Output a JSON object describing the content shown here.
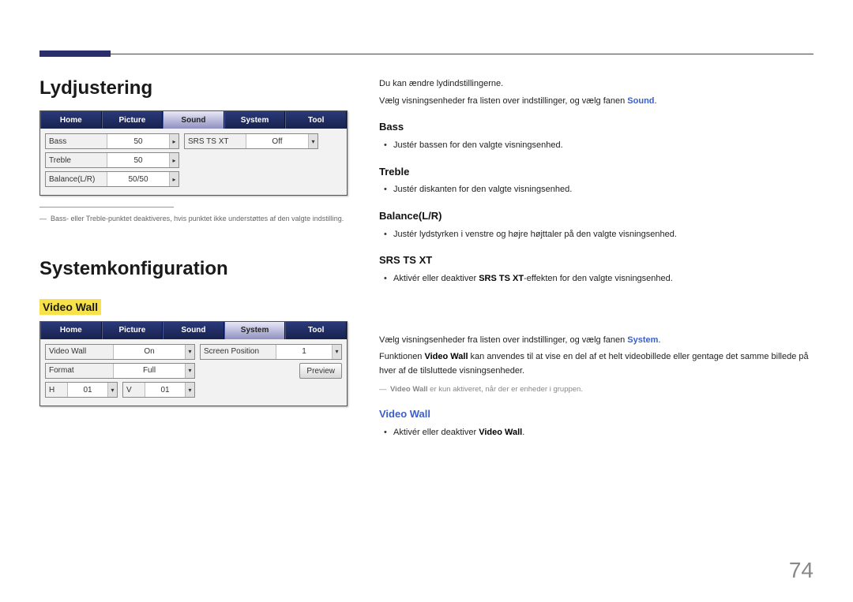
{
  "page_number": "74",
  "section1": {
    "title": "Lydjustering",
    "tabs": {
      "home": "Home",
      "picture": "Picture",
      "sound": "Sound",
      "system": "System",
      "tool": "Tool"
    },
    "fields": {
      "bass_label": "Bass",
      "bass_val": "50",
      "treble_label": "Treble",
      "treble_val": "50",
      "balance_label": "Balance(L/R)",
      "balance_val": "50/50",
      "srs_label": "SRS TS XT",
      "srs_val": "Off"
    },
    "footnote_pre": "Bass",
    "footnote_mid": "- eller ",
    "footnote_item": "Treble",
    "footnote_post": "-punktet deaktiveres, hvis punktet ikke understøttes af den valgte indstilling."
  },
  "section2": {
    "title": "Systemkonfiguration",
    "highlight": "Video Wall",
    "tabs": {
      "home": "Home",
      "picture": "Picture",
      "sound": "Sound",
      "system": "System",
      "tool": "Tool"
    },
    "fields": {
      "vw_label": "Video Wall",
      "vw_val": "On",
      "format_label": "Format",
      "format_val": "Full",
      "h_label": "H",
      "h_val": "01",
      "v_label": "V",
      "v_val": "01",
      "sp_label": "Screen Position",
      "sp_val": "1",
      "preview": "Preview"
    }
  },
  "right": {
    "intro1": "Du kan ændre lydindstillingerne.",
    "intro2a": "Vælg visningsenheder fra listen over indstillinger, og vælg fanen ",
    "intro2b": "Sound",
    "intro2c": ".",
    "bass_h": "Bass",
    "bass_b": "Justér bassen for den valgte visningsenhed.",
    "treble_h": "Treble",
    "treble_b": "Justér diskanten for den valgte visningsenhed.",
    "bal_h": "Balance(L/R)",
    "bal_b": "Justér lydstyrken i venstre og højre højttaler på den valgte visningsenhed.",
    "srs_h": "SRS TS XT",
    "srs_b1": "Aktivér eller deaktiver ",
    "srs_b2": "SRS TS XT",
    "srs_b3": "-effekten for den valgte visningsenhed.",
    "sys_l1a": "Vælg visningsenheder fra listen over indstillinger, og vælg fanen ",
    "sys_l1b": "System",
    "sys_l1c": ".",
    "sys_l2a": "Funktionen ",
    "sys_l2b": "Video Wall",
    "sys_l2c": " kan anvendes til at vise en del af et helt videobillede eller gentage det samme billede på hver af de tilsluttede visningsenheder.",
    "sys_note_a": "Video Wall",
    "sys_note_b": " er kun aktiveret, når der er enheder i gruppen.",
    "vw_h": "Video Wall",
    "vw_b1": "Aktivér eller deaktiver ",
    "vw_b2": "Video Wall",
    "vw_b3": "."
  }
}
